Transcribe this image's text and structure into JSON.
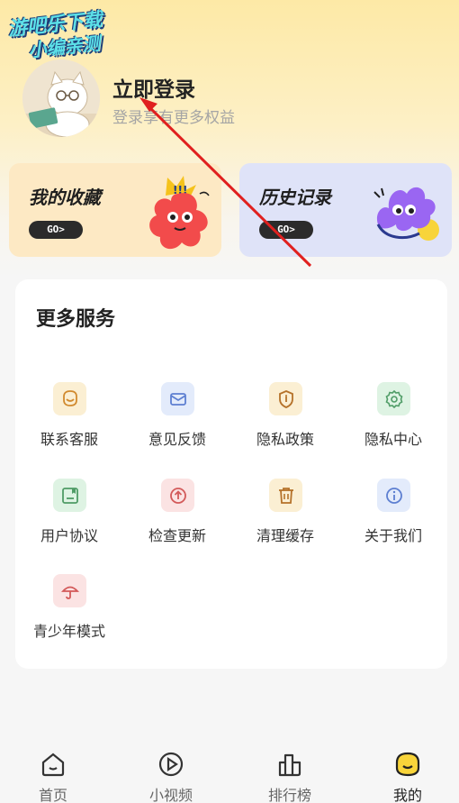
{
  "watermark": {
    "line1": "游吧乐下载",
    "line2": "小编亲测"
  },
  "profile": {
    "login_title": "立即登录",
    "login_subtitle": "登录享有更多权益"
  },
  "cards": {
    "favorites": {
      "title": "我的收藏",
      "go": "GO>"
    },
    "history": {
      "title": "历史记录",
      "go": "GO>"
    }
  },
  "services": {
    "title": "更多服务",
    "items": [
      {
        "label": "联系客服",
        "icon": "customer-service-icon",
        "bg": "#fbefd3",
        "color": "#d18a2e"
      },
      {
        "label": "意见反馈",
        "icon": "feedback-icon",
        "bg": "#e3ebfb",
        "color": "#5d7fd1"
      },
      {
        "label": "隐私政策",
        "icon": "shield-icon",
        "bg": "#fbefd3",
        "color": "#b5722a"
      },
      {
        "label": "隐私中心",
        "icon": "gear-icon",
        "bg": "#def3e3",
        "color": "#4f9c66"
      },
      {
        "label": "用户协议",
        "icon": "agreement-icon",
        "bg": "#def3e3",
        "color": "#4f9c66"
      },
      {
        "label": "检查更新",
        "icon": "update-icon",
        "bg": "#fbe3e3",
        "color": "#d35a5a"
      },
      {
        "label": "清理缓存",
        "icon": "trash-icon",
        "bg": "#fbefd3",
        "color": "#b5722a"
      },
      {
        "label": "关于我们",
        "icon": "info-icon",
        "bg": "#e3ebfb",
        "color": "#5d7fd1"
      },
      {
        "label": "青少年模式",
        "icon": "umbrella-icon",
        "bg": "#fbe3e3",
        "color": "#d35a5a"
      }
    ]
  },
  "tabbar": {
    "items": [
      {
        "label": "首页",
        "icon": "home-icon"
      },
      {
        "label": "小视频",
        "icon": "play-icon"
      },
      {
        "label": "排行榜",
        "icon": "ranking-icon"
      },
      {
        "label": "我的",
        "icon": "profile-icon",
        "active": true
      }
    ]
  }
}
